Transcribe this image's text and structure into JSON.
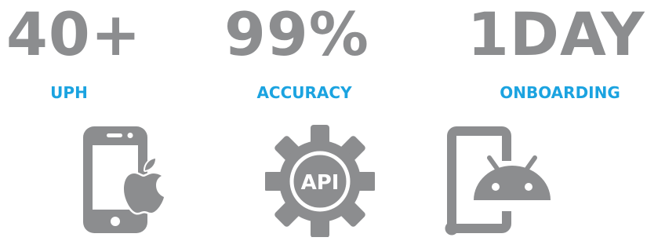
{
  "colors": {
    "number": "#8c8d8f",
    "label": "#1ba3e0",
    "icon": "#8c8d8f"
  },
  "stats": [
    {
      "value": "40+",
      "label": "UPH"
    },
    {
      "value": "99%",
      "label": "ACCURACY"
    },
    {
      "value": "1DAY",
      "label": "ONBOARDING"
    }
  ],
  "icons": [
    {
      "name": "iphone-apple-icon"
    },
    {
      "name": "api-gear-icon",
      "text": "API"
    },
    {
      "name": "android-tablet-icon"
    }
  ]
}
